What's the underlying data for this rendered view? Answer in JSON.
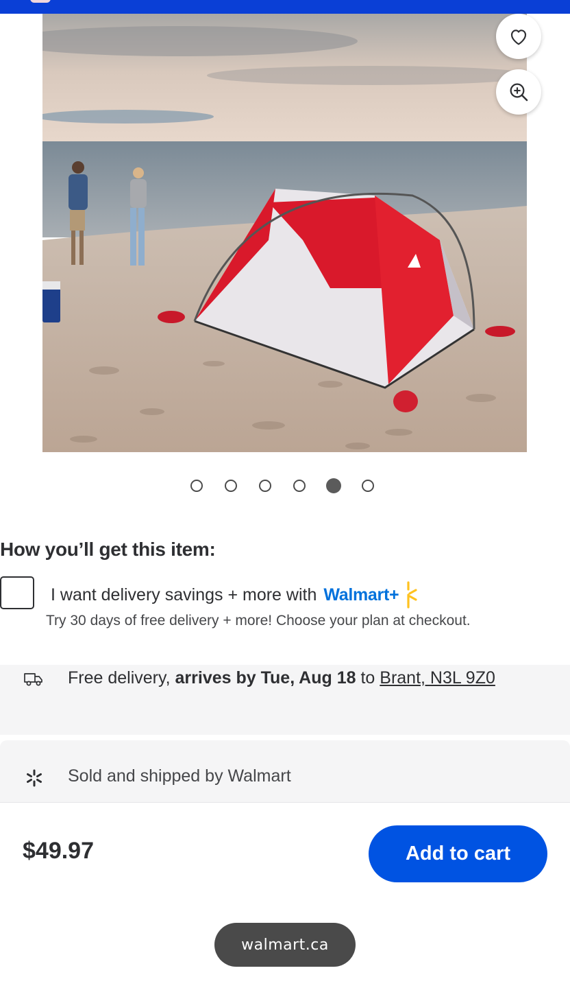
{
  "gallery": {
    "image_alt": "Red beach tent on sandy shore with two people walking",
    "dot_count": 6,
    "active_dot_index": 4
  },
  "icons": {
    "favorite": "heart-icon",
    "zoom": "zoom-in-icon",
    "delivery": "truck-icon",
    "seller": "walmart-spark-icon"
  },
  "fulfillment": {
    "title": "How you’ll get this item:",
    "walmart_plus_label": "I want delivery savings + more with",
    "walmart_plus_brand": "Walmart+",
    "walmart_plus_subtext": "Try 30 days of free delivery + more! Choose your plan at checkout.",
    "delivery_prefix": "Free delivery, ",
    "delivery_date": "arrives by Tue, Aug 18",
    "delivery_to": " to ",
    "delivery_location": "Brant, N3L 9Z0",
    "seller": "Sold and shipped by Walmart"
  },
  "purchase": {
    "price": "$49.97",
    "add_to_cart_label": "Add to cart"
  },
  "browser": {
    "url": "walmart.ca"
  },
  "colors": {
    "brand_blue": "#0053e2",
    "walmart_plus_blue": "#0071dc",
    "spark_yellow": "#ffc220",
    "top_bar": "#0a3fd6"
  }
}
